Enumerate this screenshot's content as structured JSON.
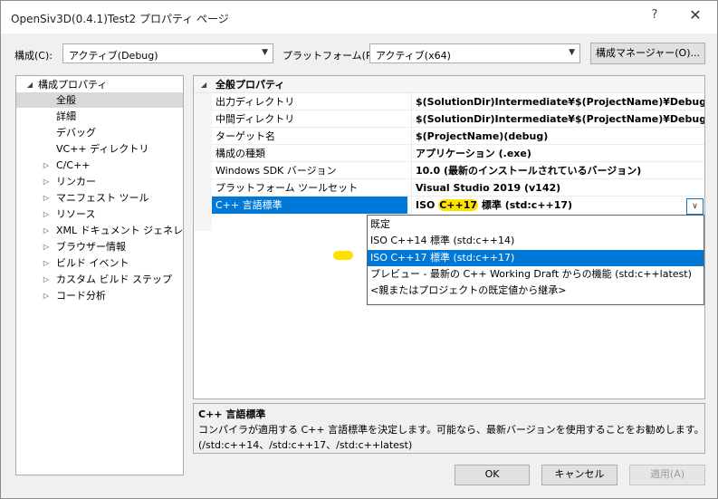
{
  "window": {
    "title": "OpenSiv3D(0.4.1)Test2 プロパティ ページ",
    "help_glyph": "?",
    "close_glyph": "✕"
  },
  "toolbar": {
    "config_label": "構成(C):",
    "config_value": "アクティブ(Debug)",
    "platform_label": "プラットフォーム(P):",
    "platform_value": "アクティブ(x64)",
    "config_manager_label": "構成マネージャー(O)..."
  },
  "tree": {
    "items": [
      {
        "label": "構成プロパティ",
        "expander": "◢",
        "level": "root"
      },
      {
        "label": "全般",
        "expander": "",
        "level": "child",
        "selected": true
      },
      {
        "label": "詳細",
        "expander": "",
        "level": "child"
      },
      {
        "label": "デバッグ",
        "expander": "",
        "level": "child"
      },
      {
        "label": "VC++ ディレクトリ",
        "expander": "",
        "level": "child"
      },
      {
        "label": "C/C++",
        "expander": "▷",
        "level": "group"
      },
      {
        "label": "リンカー",
        "expander": "▷",
        "level": "group"
      },
      {
        "label": "マニフェスト ツール",
        "expander": "▷",
        "level": "group"
      },
      {
        "label": "リソース",
        "expander": "▷",
        "level": "group"
      },
      {
        "label": "XML ドキュメント ジェネレーター",
        "expander": "▷",
        "level": "group"
      },
      {
        "label": "ブラウザー情報",
        "expander": "▷",
        "level": "group"
      },
      {
        "label": "ビルド イベント",
        "expander": "▷",
        "level": "group"
      },
      {
        "label": "カスタム ビルド ステップ",
        "expander": "▷",
        "level": "group"
      },
      {
        "label": "コード分析",
        "expander": "▷",
        "level": "group"
      }
    ]
  },
  "grid": {
    "category": "全般プロパティ",
    "category_expander": "◢",
    "rows": [
      {
        "name": "出力ディレクトリ",
        "value": "$(SolutionDir)Intermediate¥$(ProjectName)¥Debug¥"
      },
      {
        "name": "中間ディレクトリ",
        "value": "$(SolutionDir)Intermediate¥$(ProjectName)¥Debug¥Intermediate¥"
      },
      {
        "name": "ターゲット名",
        "value": "$(ProjectName)(debug)"
      },
      {
        "name": "構成の種類",
        "value": "アプリケーション (.exe)"
      },
      {
        "name": "Windows SDK バージョン",
        "value": "10.0 (最新のインストールされているバージョン)"
      },
      {
        "name": "プラットフォーム ツールセット",
        "value": "Visual Studio 2019 (v142)"
      }
    ],
    "selected_row": {
      "name": "C++ 言語標準",
      "value_prefix": "ISO ",
      "value_highlight": "C++17",
      "value_suffix": " 標準 (std:c++17)"
    },
    "dropdown_arrow": "∨"
  },
  "dropdown": {
    "options": [
      {
        "label": "既定",
        "selected": false
      },
      {
        "label": "ISO C++14 標準 (std:c++14)",
        "selected": false
      },
      {
        "label": "ISO C++17 標準 (std:c++17)",
        "selected": true
      },
      {
        "label": "プレビュー - 最新の C++ Working Draft からの機能 (std:c++latest)",
        "selected": false
      },
      {
        "label": "<親またはプロジェクトの既定値から継承>",
        "selected": false
      }
    ]
  },
  "description": {
    "title": "C++ 言語標準",
    "line1": "コンパイラが適用する C++ 言語標準を決定します。可能なら、最新バージョンを使用することをお勧めします。",
    "line2": "(/std:c++14、/std:c++17、/std:c++latest)"
  },
  "buttons": {
    "ok": "OK",
    "cancel": "キャンセル",
    "apply": "適用(A)"
  },
  "colors": {
    "selection": "#0078d7",
    "highlighter": "#ffe100"
  }
}
